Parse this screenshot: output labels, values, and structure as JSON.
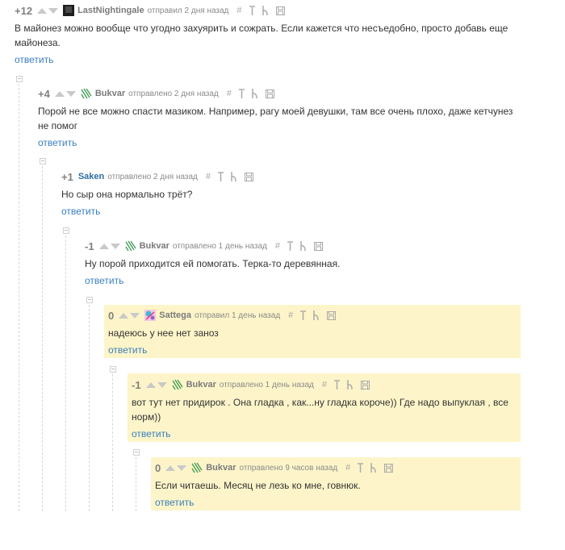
{
  "comments": [
    {
      "rating": "+12",
      "username": "LastNightingale",
      "verb_time": "отправил 2 дня назад",
      "text": "В майонез можно вообще что угодно захуярить и сожрать. Если кажется что несъедобно, просто добавь еще майонеза.",
      "reply": "ответить",
      "avatar": "dark-square-avatar"
    },
    {
      "rating": "+4",
      "username": "Bukvar",
      "verb_time": "отправлено 2 дня назад",
      "text": "Порой не все можно спасти мазиком. Например, рагу моей девушки, там все очень плохо, даже кетчунез не помог",
      "reply": "ответить",
      "avatar": "green-lines-avatar"
    },
    {
      "rating": "+1",
      "username": "Saken",
      "verb_time": "отправлено 2 дня назад",
      "text": "Но сыр она нормально трёт?",
      "reply": "ответить",
      "avatar": "none"
    },
    {
      "rating": "-1",
      "username": "Bukvar",
      "verb_time": "отправлено 1 день назад",
      "text": "Ну порой приходится ей помогать. Терка-то деревянная.",
      "reply": "ответить",
      "avatar": "green-lines-avatar"
    },
    {
      "rating": "0",
      "username": "Sattega",
      "verb_time": "отправил 1 день назад",
      "text": "надеюсь у нее нет заноз",
      "reply": "ответить",
      "avatar": "pink-cyan-avatar"
    },
    {
      "rating": "-1",
      "username": "Bukvar",
      "verb_time": "отправлено 1 день назад",
      "text": "вот тут нет придирок . Она гладка , как...ну гладка короче)) Где надо выпуклая , все норм))",
      "reply": "ответить",
      "avatar": "green-lines-avatar"
    },
    {
      "rating": "0",
      "username": "Bukvar",
      "verb_time": "отправлено 9 часов назад",
      "text": "Если читаешь. Месяц не лезь ко мне, говнюк.",
      "reply": "ответить",
      "avatar": "green-lines-avatar"
    }
  ],
  "tools": {
    "hash": "#",
    "icons": [
      "hash-icon",
      "pin-up-icon",
      "branch-icon",
      "save-icon"
    ]
  },
  "colors": {
    "highlight": "#fdf5c9",
    "link": "#3a7fc0",
    "username": "#7a7a7a",
    "username_blue": "#2d6ea3",
    "meta": "#8a8a8a",
    "rating": "#808080"
  }
}
